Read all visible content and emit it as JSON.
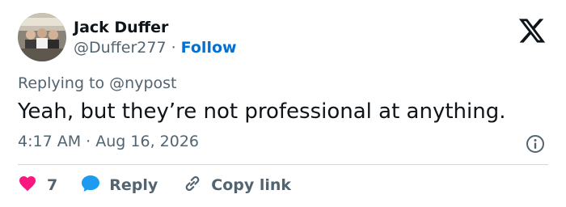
{
  "author": {
    "display_name": "Jack Duffer",
    "handle": "@Duffer277",
    "separator": "·",
    "follow_label": "Follow"
  },
  "reply": {
    "prefix": "Replying to ",
    "mention": "@nypost"
  },
  "tweet": {
    "text": "Yeah, but they’re not professional at anything.",
    "time": "4:17 AM",
    "separator": "·",
    "date": "Aug 16, 2026"
  },
  "actions": {
    "like_count": "7",
    "reply_label": "Reply",
    "copy_label": "Copy link"
  },
  "icons": {
    "brand": "x-logo-icon",
    "info": "info-icon",
    "like": "heart-icon",
    "reply": "speech-bubble-icon",
    "copy": "link-icon"
  },
  "colors": {
    "text": "#0f1419",
    "secondary": "#536471",
    "link": "#006fd6",
    "like": "#f91880",
    "reply_bubble": "#1d9bf0",
    "divider": "#cfd9de"
  }
}
